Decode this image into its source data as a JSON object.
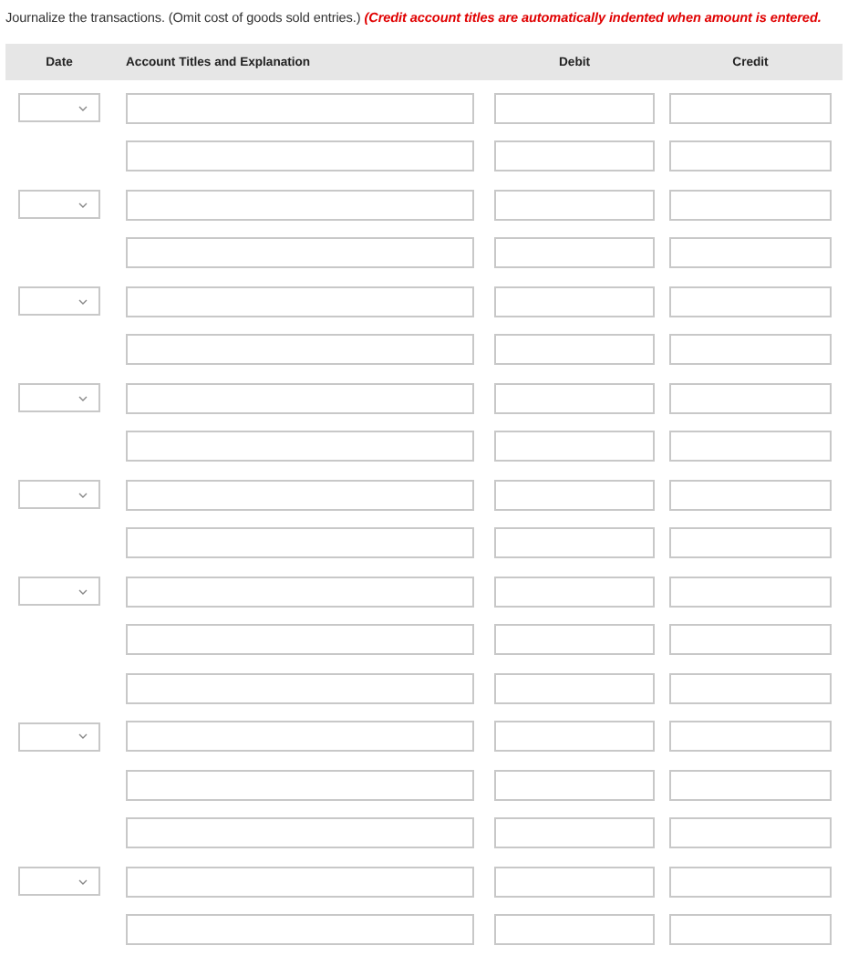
{
  "instruction": "Journalize the transactions. (Omit cost of goods sold entries.) **(Credit account titles are automatically indented when amount is entered.**",
  "table": {
    "columns": [
      "Date",
      "Account Titles and Explanation",
      "Debit",
      "Credit"
    ],
    "rows": [
      {
        "date_field": true
      },
      {
        "date_field": false
      },
      {
        "date_field": true
      },
      {
        "date_field": false
      },
      {
        "date_field": true
      },
      {
        "date_field": false
      },
      {
        "date_field": true
      },
      {
        "date_field": false
      },
      {
        "date_field": true
      },
      {
        "date_field": false
      },
      {
        "date_field": true
      },
      {
        "date_field": false
      },
      {
        "date_field": false
      },
      {
        "date_field": true
      },
      {
        "date_field": false
      },
      {
        "date_field": false
      },
      {
        "date_field": true
      },
      {
        "date_field": false
      }
    ]
  }
}
